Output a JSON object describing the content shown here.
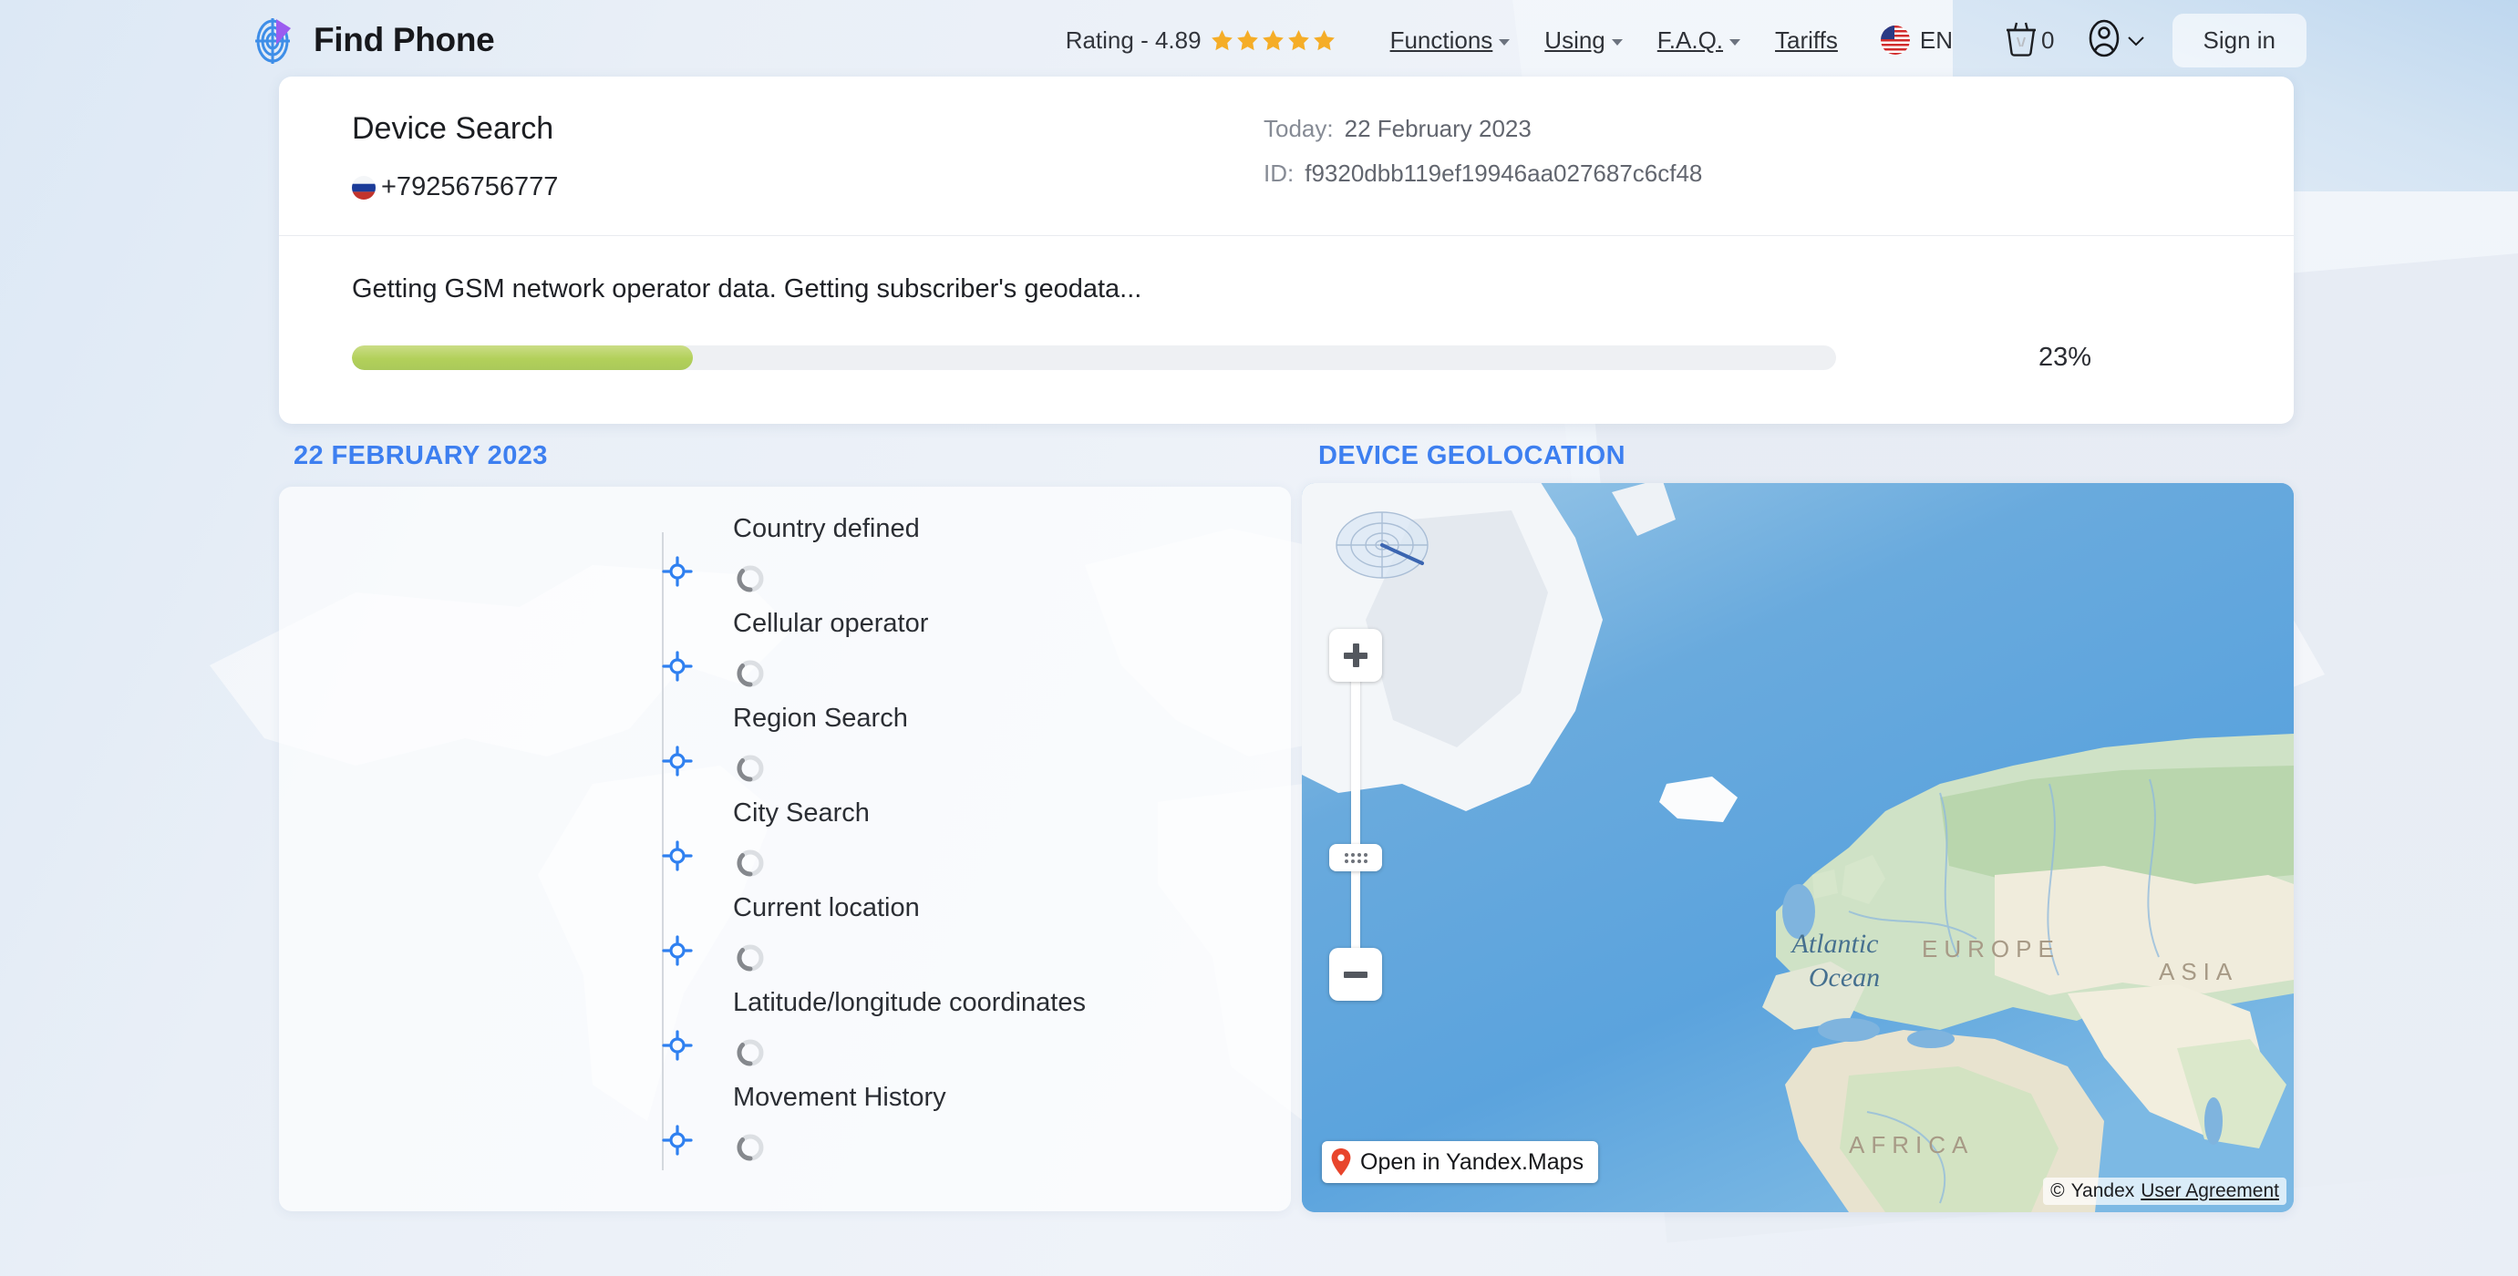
{
  "brand": {
    "name": "Find Phone",
    "logo_icon": "radar-target-icon"
  },
  "header": {
    "rating": {
      "label": "Rating - 4.89",
      "stars": 5,
      "star_color": "#f5ad27"
    },
    "nav_items": [
      {
        "label": "Functions",
        "has_dropdown": true
      },
      {
        "label": "Using",
        "has_dropdown": true
      },
      {
        "label": "F.A.Q.",
        "has_dropdown": true
      },
      {
        "label": "Tariffs",
        "has_dropdown": false
      }
    ],
    "language": {
      "code": "EN",
      "flag_icon": "us-flag-icon"
    },
    "cart": {
      "icon": "basket-icon",
      "count": "0"
    },
    "account": {
      "icon": "user-circle-icon",
      "chevron": "chevron-down-icon"
    },
    "sign_in_label": "Sign in"
  },
  "search_card": {
    "title": "Device Search",
    "phone_flag_icon": "ru-flag-icon",
    "phone_number": "+79256756777",
    "today_label": "Today:",
    "today_value": "22 February 2023",
    "id_label": "ID:",
    "id_value": "f9320dbb119ef19946aa027687c6cf48",
    "status_text": "Getting GSM network operator data. Getting subscriber's geodata...",
    "progress_percent": 23,
    "progress_percent_label": "23%",
    "progress_color": "#b2d05a"
  },
  "timeline": {
    "heading": "22 FEBRUARY 2023",
    "heading_color": "#3d7ff0",
    "marker_icon": "location-crosshair-icon",
    "spinner_icon": "loading-spinner-icon",
    "items": [
      {
        "label": "Country defined",
        "state": "loading"
      },
      {
        "label": "Cellular operator",
        "state": "loading"
      },
      {
        "label": "Region Search",
        "state": "loading"
      },
      {
        "label": "City Search",
        "state": "loading"
      },
      {
        "label": "Current location",
        "state": "loading"
      },
      {
        "label": "Latitude/longitude coordinates",
        "state": "loading"
      },
      {
        "label": "Movement History",
        "state": "loading"
      }
    ]
  },
  "map": {
    "heading": "DEVICE GEOLOCATION",
    "heading_color": "#3d7ff0",
    "radar_icon": "radar-compass-icon",
    "zoom_in_label": "+",
    "zoom_out_label": "−",
    "zoom_handle_icon": "drag-handle-icon",
    "open_button_label": "Open in Yandex.Maps",
    "open_button_icon": "map-pin-icon",
    "credit_symbol": "©",
    "credit_provider": "Yandex",
    "credit_link": "User Agreement",
    "labels": [
      {
        "text": "Atlantic\nOcean",
        "kind": "ocean"
      },
      {
        "text": "EUROPE",
        "kind": "continent"
      },
      {
        "text": "ASIA",
        "kind": "continent"
      },
      {
        "text": "AFRICA",
        "kind": "continent"
      }
    ]
  }
}
